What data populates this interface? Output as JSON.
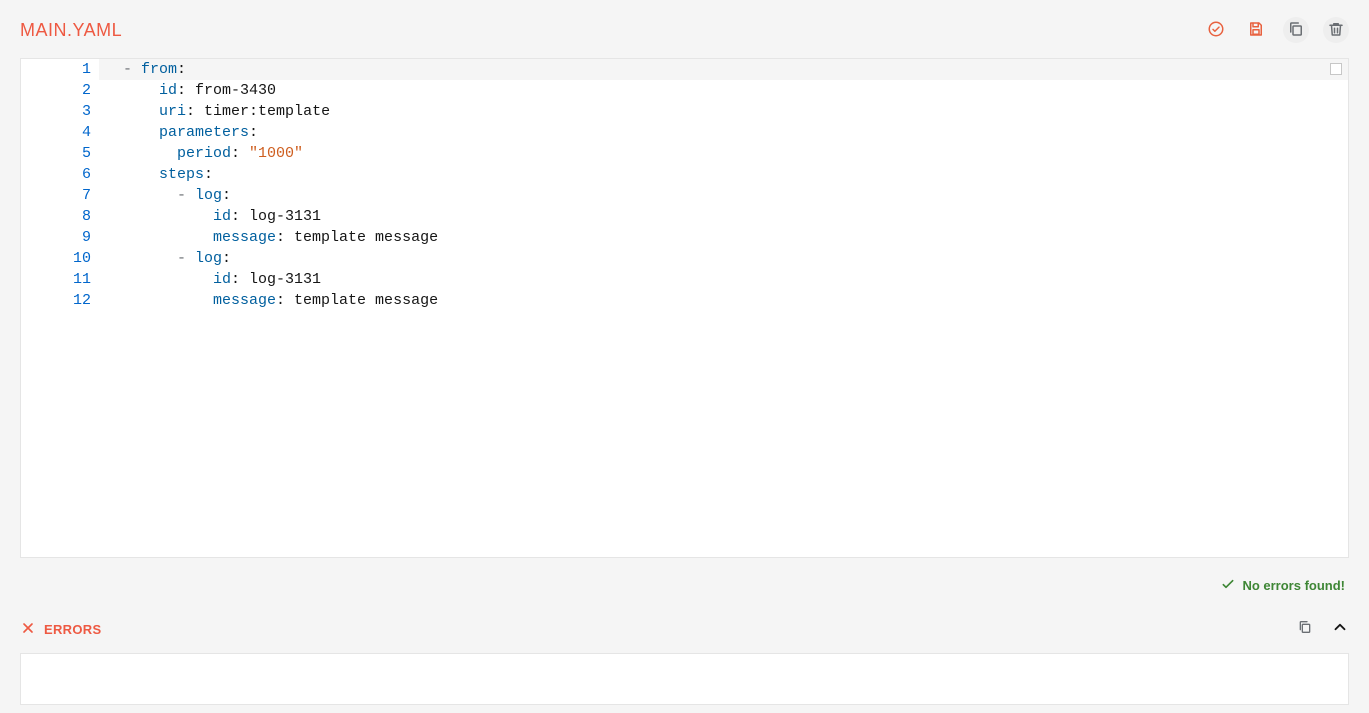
{
  "header": {
    "title": "MAIN.YAML",
    "actions": {
      "validate": "validate",
      "save": "save",
      "copy": "copy",
      "delete": "delete"
    }
  },
  "editor": {
    "active_line": 1,
    "line_count": 12,
    "lines": [
      {
        "n": "1",
        "tokens": [
          {
            "t": "- ",
            "c": "dash"
          },
          {
            "t": "from",
            "c": "key"
          },
          {
            "t": ":",
            "c": "colon"
          }
        ]
      },
      {
        "n": "2",
        "tokens": [
          {
            "t": "    ",
            "c": "plain"
          },
          {
            "t": "id",
            "c": "key"
          },
          {
            "t": ": ",
            "c": "colon"
          },
          {
            "t": "from-3430",
            "c": "plain"
          }
        ]
      },
      {
        "n": "3",
        "tokens": [
          {
            "t": "    ",
            "c": "plain"
          },
          {
            "t": "uri",
            "c": "key"
          },
          {
            "t": ": ",
            "c": "colon"
          },
          {
            "t": "timer:template",
            "c": "plain"
          }
        ]
      },
      {
        "n": "4",
        "tokens": [
          {
            "t": "    ",
            "c": "plain"
          },
          {
            "t": "parameters",
            "c": "key"
          },
          {
            "t": ":",
            "c": "colon"
          }
        ]
      },
      {
        "n": "5",
        "tokens": [
          {
            "t": "      ",
            "c": "plain"
          },
          {
            "t": "period",
            "c": "key"
          },
          {
            "t": ": ",
            "c": "colon"
          },
          {
            "t": "\"1000\"",
            "c": "str"
          }
        ]
      },
      {
        "n": "6",
        "tokens": [
          {
            "t": "    ",
            "c": "plain"
          },
          {
            "t": "steps",
            "c": "key"
          },
          {
            "t": ":",
            "c": "colon"
          }
        ]
      },
      {
        "n": "7",
        "tokens": [
          {
            "t": "      - ",
            "c": "dash"
          },
          {
            "t": "log",
            "c": "key"
          },
          {
            "t": ":",
            "c": "colon"
          }
        ]
      },
      {
        "n": "8",
        "tokens": [
          {
            "t": "          ",
            "c": "plain"
          },
          {
            "t": "id",
            "c": "key"
          },
          {
            "t": ": ",
            "c": "colon"
          },
          {
            "t": "log-3131",
            "c": "plain"
          }
        ]
      },
      {
        "n": "9",
        "tokens": [
          {
            "t": "          ",
            "c": "plain"
          },
          {
            "t": "message",
            "c": "key"
          },
          {
            "t": ": ",
            "c": "colon"
          },
          {
            "t": "template message",
            "c": "plain"
          }
        ]
      },
      {
        "n": "10",
        "tokens": [
          {
            "t": "      - ",
            "c": "dash"
          },
          {
            "t": "log",
            "c": "key"
          },
          {
            "t": ":",
            "c": "colon"
          }
        ]
      },
      {
        "n": "11",
        "tokens": [
          {
            "t": "          ",
            "c": "plain"
          },
          {
            "t": "id",
            "c": "key"
          },
          {
            "t": ": ",
            "c": "colon"
          },
          {
            "t": "log-3131",
            "c": "plain"
          }
        ]
      },
      {
        "n": "12",
        "tokens": [
          {
            "t": "          ",
            "c": "plain"
          },
          {
            "t": "message",
            "c": "key"
          },
          {
            "t": ": ",
            "c": "colon"
          },
          {
            "t": "template message",
            "c": "plain"
          }
        ]
      }
    ]
  },
  "status": {
    "no_errors_label": "No errors found!"
  },
  "errors_panel": {
    "title": "ERRORS"
  }
}
